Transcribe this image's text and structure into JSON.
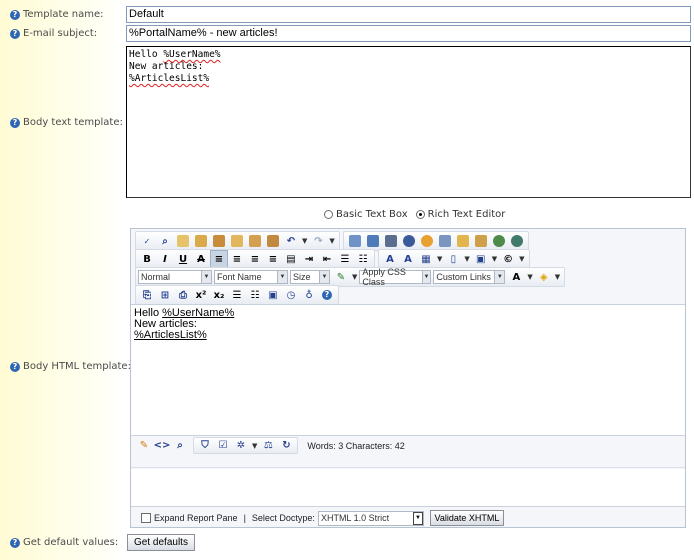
{
  "labels": {
    "template_name": "Template name:",
    "email_subject": "E-mail subject:",
    "body_text": "Body text template:",
    "body_html": "Body HTML template:",
    "get_default": "Get default values:"
  },
  "fields": {
    "template_name": "Default",
    "email_subject": "%PortalName% - new articles!",
    "body_text": {
      "line1_prefix": "Hello ",
      "line1_var": "%UserName%",
      "line2": "New articles:",
      "line3_var": "%ArticlesList%"
    }
  },
  "mode": {
    "basic": "Basic Text Box",
    "rich": "Rich Text Editor",
    "selected": "rich"
  },
  "editor": {
    "toolbar": {
      "format": "Normal",
      "font_name": "Font Name",
      "size": "Size",
      "css_class": "Apply CSS Class",
      "custom_links": "Custom Links"
    },
    "content": {
      "line1_prefix": "Hello ",
      "line1_var": "%UserName%",
      "line2": "New articles:",
      "line3_var": "%ArticlesList%"
    },
    "status": "Words: 3 Characters: 42",
    "footer": {
      "expand_report": "Expand Report Pane",
      "separator": "|",
      "select_doctype": "Select Doctype:",
      "doctype": "XHTML 1.0 Strict",
      "validate": "Validate XHTML"
    }
  },
  "get_defaults_button": "Get defaults",
  "icons": [
    "help-icon",
    "spellcheck-icon",
    "find-icon",
    "cut-icon",
    "copy-icon",
    "paste-icon",
    "undo-icon",
    "redo-icon",
    "image-icon",
    "table-icon",
    "bold-icon",
    "italic-icon",
    "underline-icon",
    "strike-icon",
    "align-left-icon",
    "link-icon",
    "superscript-icon",
    "subscript-icon"
  ],
  "colors": {
    "help_blue": "#2f67b2",
    "label_bg": "#fffbd4",
    "editor_border": "#b8c4d4"
  }
}
